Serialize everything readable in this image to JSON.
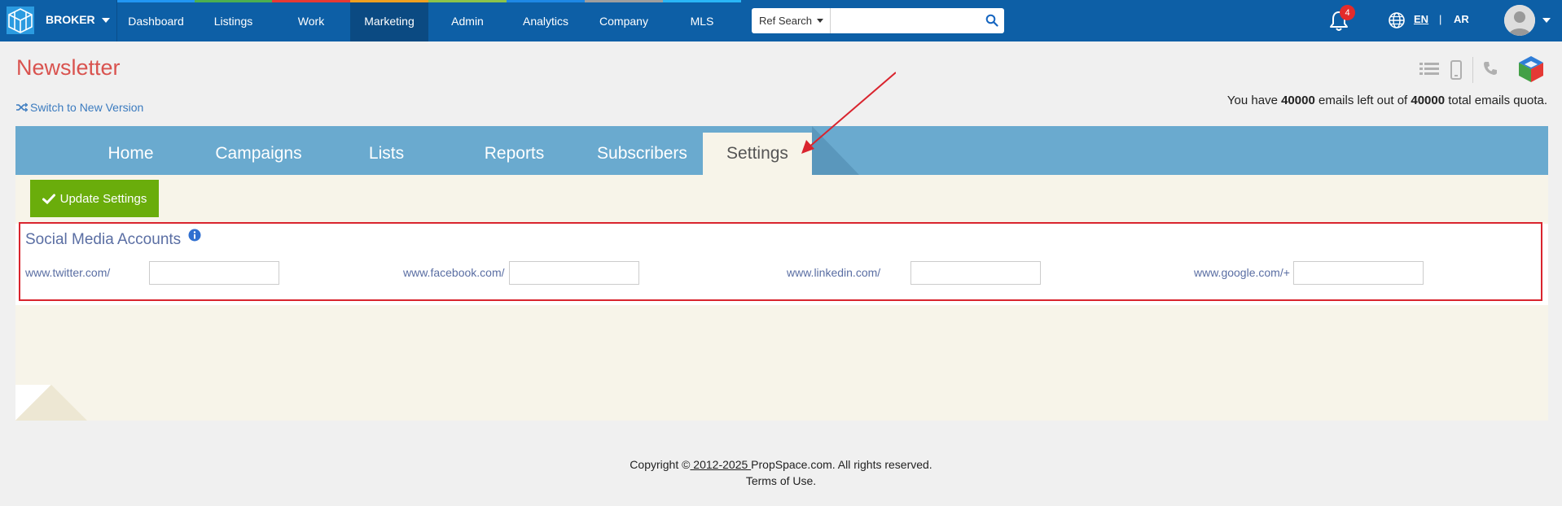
{
  "topbar": {
    "broker_label": "BROKER",
    "nav": [
      {
        "label": "Dashboard",
        "stripe": "#2196f3"
      },
      {
        "label": "Listings",
        "stripe": "#4caf50"
      },
      {
        "label": "Work",
        "stripe": "#e53935"
      },
      {
        "label": "Marketing",
        "stripe": "#f0a020"
      },
      {
        "label": "Admin",
        "stripe": "#8bc34a"
      },
      {
        "label": "Analytics",
        "stripe": "#1e88e5"
      },
      {
        "label": "Company",
        "stripe": "#9e9e9e"
      },
      {
        "label": "MLS",
        "stripe": "#29b6f6"
      }
    ],
    "active_nav": "Marketing",
    "ref_search_label": "Ref Search",
    "search_placeholder": "",
    "notification_count": "4",
    "lang_en": "EN",
    "lang_sep": "|",
    "lang_ar": "AR"
  },
  "page": {
    "title": "Newsletter",
    "switch_link": "Switch to New Version",
    "quota_prefix": "You have ",
    "quota_left": "40000",
    "quota_mid": " emails left out of ",
    "quota_total": "40000",
    "quota_suffix": " total emails quota."
  },
  "tabs": [
    {
      "label": "Home"
    },
    {
      "label": "Campaigns"
    },
    {
      "label": "Lists"
    },
    {
      "label": "Reports"
    },
    {
      "label": "Subscribers"
    },
    {
      "label": "Settings"
    }
  ],
  "active_tab": "Settings",
  "settings": {
    "update_button": "Update Settings",
    "social_title": "Social Media Accounts",
    "accounts": [
      {
        "label": "www.twitter.com/",
        "value": ""
      },
      {
        "label": "www.facebook.com/",
        "value": ""
      },
      {
        "label": "www.linkedin.com/",
        "value": ""
      },
      {
        "label": "www.google.com/+",
        "value": ""
      }
    ]
  },
  "footer": {
    "copy_prefix": "Copyright ©",
    "copy_years": " 2012-2025 ",
    "copy_suffix": "PropSpace.com. All rights reserved.",
    "terms": "Terms of Use."
  },
  "colors": {
    "topbar": "#0d5fa6",
    "title": "#d9534f",
    "tab_bar": "#6aaacf",
    "update_button": "#6aad0b",
    "highlight": "#d9242e"
  },
  "icons": [
    "logo-icon",
    "chevron-down-icon",
    "search-icon",
    "bell-icon",
    "globe-icon",
    "avatar-icon",
    "shuffle-icon",
    "list-icon",
    "mobile-icon",
    "phone-icon",
    "cube-icon",
    "check-icon",
    "info-icon",
    "arrow-annotation"
  ]
}
